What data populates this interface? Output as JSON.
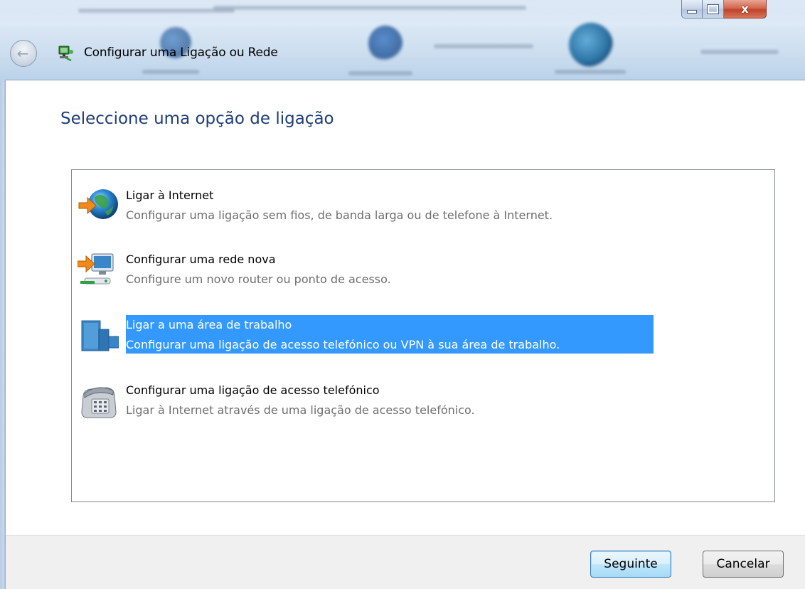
{
  "window": {
    "title": "Configurar uma Ligação ou Rede",
    "controls": {
      "minimize": "minimize",
      "maximize": "maximize",
      "close": "x"
    }
  },
  "heading": "Seleccione uma opção de ligação",
  "options": [
    {
      "icon": "globe-internet-icon",
      "title": "Ligar à Internet",
      "description": "Configurar uma ligação sem fios, de banda larga ou de telefone à Internet.",
      "selected": false
    },
    {
      "icon": "new-network-icon",
      "title": "Configurar uma rede nova",
      "description": "Configure um novo router ou ponto de acesso.",
      "selected": false
    },
    {
      "icon": "workplace-icon",
      "title": "Ligar a uma área de trabalho",
      "description": "Configurar uma ligação de acesso telefónico ou VPN à sua área de trabalho.",
      "selected": true
    },
    {
      "icon": "dialup-phone-icon",
      "title": "Configurar uma ligação de acesso telefónico",
      "description": "Ligar à Internet através de uma ligação de acesso telefónico.",
      "selected": false
    }
  ],
  "buttons": {
    "next": "Seguinte",
    "cancel": "Cancelar"
  },
  "colors": {
    "heading": "#1e3d79",
    "selection": "#3399ff",
    "description": "#6d6d6d"
  }
}
